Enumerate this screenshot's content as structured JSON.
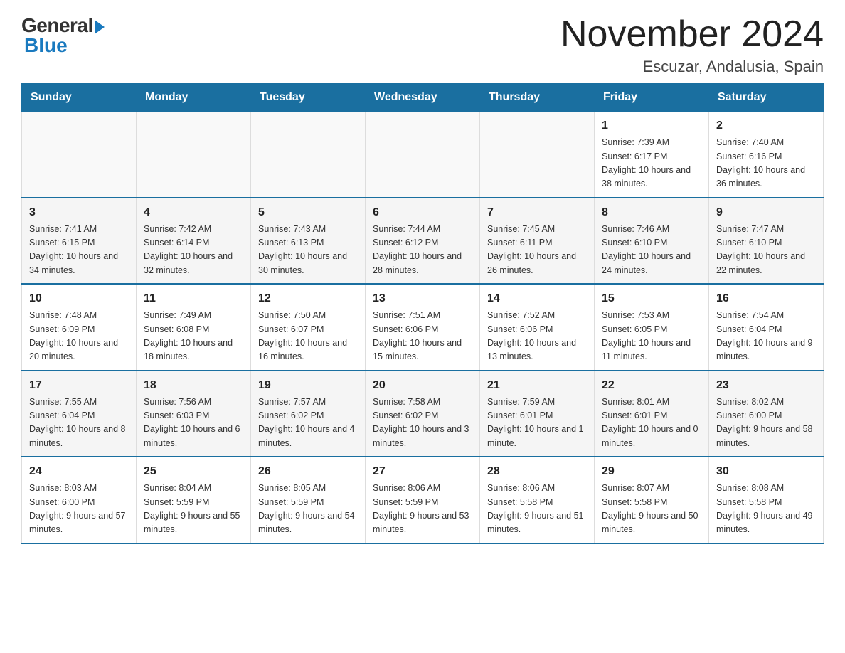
{
  "header": {
    "logo_general": "General",
    "logo_blue": "Blue",
    "month_title": "November 2024",
    "location": "Escuzar, Andalusia, Spain"
  },
  "days_of_week": [
    "Sunday",
    "Monday",
    "Tuesday",
    "Wednesday",
    "Thursday",
    "Friday",
    "Saturday"
  ],
  "weeks": [
    [
      {
        "day": "",
        "info": ""
      },
      {
        "day": "",
        "info": ""
      },
      {
        "day": "",
        "info": ""
      },
      {
        "day": "",
        "info": ""
      },
      {
        "day": "",
        "info": ""
      },
      {
        "day": "1",
        "info": "Sunrise: 7:39 AM\nSunset: 6:17 PM\nDaylight: 10 hours and 38 minutes."
      },
      {
        "day": "2",
        "info": "Sunrise: 7:40 AM\nSunset: 6:16 PM\nDaylight: 10 hours and 36 minutes."
      }
    ],
    [
      {
        "day": "3",
        "info": "Sunrise: 7:41 AM\nSunset: 6:15 PM\nDaylight: 10 hours and 34 minutes."
      },
      {
        "day": "4",
        "info": "Sunrise: 7:42 AM\nSunset: 6:14 PM\nDaylight: 10 hours and 32 minutes."
      },
      {
        "day": "5",
        "info": "Sunrise: 7:43 AM\nSunset: 6:13 PM\nDaylight: 10 hours and 30 minutes."
      },
      {
        "day": "6",
        "info": "Sunrise: 7:44 AM\nSunset: 6:12 PM\nDaylight: 10 hours and 28 minutes."
      },
      {
        "day": "7",
        "info": "Sunrise: 7:45 AM\nSunset: 6:11 PM\nDaylight: 10 hours and 26 minutes."
      },
      {
        "day": "8",
        "info": "Sunrise: 7:46 AM\nSunset: 6:10 PM\nDaylight: 10 hours and 24 minutes."
      },
      {
        "day": "9",
        "info": "Sunrise: 7:47 AM\nSunset: 6:10 PM\nDaylight: 10 hours and 22 minutes."
      }
    ],
    [
      {
        "day": "10",
        "info": "Sunrise: 7:48 AM\nSunset: 6:09 PM\nDaylight: 10 hours and 20 minutes."
      },
      {
        "day": "11",
        "info": "Sunrise: 7:49 AM\nSunset: 6:08 PM\nDaylight: 10 hours and 18 minutes."
      },
      {
        "day": "12",
        "info": "Sunrise: 7:50 AM\nSunset: 6:07 PM\nDaylight: 10 hours and 16 minutes."
      },
      {
        "day": "13",
        "info": "Sunrise: 7:51 AM\nSunset: 6:06 PM\nDaylight: 10 hours and 15 minutes."
      },
      {
        "day": "14",
        "info": "Sunrise: 7:52 AM\nSunset: 6:06 PM\nDaylight: 10 hours and 13 minutes."
      },
      {
        "day": "15",
        "info": "Sunrise: 7:53 AM\nSunset: 6:05 PM\nDaylight: 10 hours and 11 minutes."
      },
      {
        "day": "16",
        "info": "Sunrise: 7:54 AM\nSunset: 6:04 PM\nDaylight: 10 hours and 9 minutes."
      }
    ],
    [
      {
        "day": "17",
        "info": "Sunrise: 7:55 AM\nSunset: 6:04 PM\nDaylight: 10 hours and 8 minutes."
      },
      {
        "day": "18",
        "info": "Sunrise: 7:56 AM\nSunset: 6:03 PM\nDaylight: 10 hours and 6 minutes."
      },
      {
        "day": "19",
        "info": "Sunrise: 7:57 AM\nSunset: 6:02 PM\nDaylight: 10 hours and 4 minutes."
      },
      {
        "day": "20",
        "info": "Sunrise: 7:58 AM\nSunset: 6:02 PM\nDaylight: 10 hours and 3 minutes."
      },
      {
        "day": "21",
        "info": "Sunrise: 7:59 AM\nSunset: 6:01 PM\nDaylight: 10 hours and 1 minute."
      },
      {
        "day": "22",
        "info": "Sunrise: 8:01 AM\nSunset: 6:01 PM\nDaylight: 10 hours and 0 minutes."
      },
      {
        "day": "23",
        "info": "Sunrise: 8:02 AM\nSunset: 6:00 PM\nDaylight: 9 hours and 58 minutes."
      }
    ],
    [
      {
        "day": "24",
        "info": "Sunrise: 8:03 AM\nSunset: 6:00 PM\nDaylight: 9 hours and 57 minutes."
      },
      {
        "day": "25",
        "info": "Sunrise: 8:04 AM\nSunset: 5:59 PM\nDaylight: 9 hours and 55 minutes."
      },
      {
        "day": "26",
        "info": "Sunrise: 8:05 AM\nSunset: 5:59 PM\nDaylight: 9 hours and 54 minutes."
      },
      {
        "day": "27",
        "info": "Sunrise: 8:06 AM\nSunset: 5:59 PM\nDaylight: 9 hours and 53 minutes."
      },
      {
        "day": "28",
        "info": "Sunrise: 8:06 AM\nSunset: 5:58 PM\nDaylight: 9 hours and 51 minutes."
      },
      {
        "day": "29",
        "info": "Sunrise: 8:07 AM\nSunset: 5:58 PM\nDaylight: 9 hours and 50 minutes."
      },
      {
        "day": "30",
        "info": "Sunrise: 8:08 AM\nSunset: 5:58 PM\nDaylight: 9 hours and 49 minutes."
      }
    ]
  ]
}
